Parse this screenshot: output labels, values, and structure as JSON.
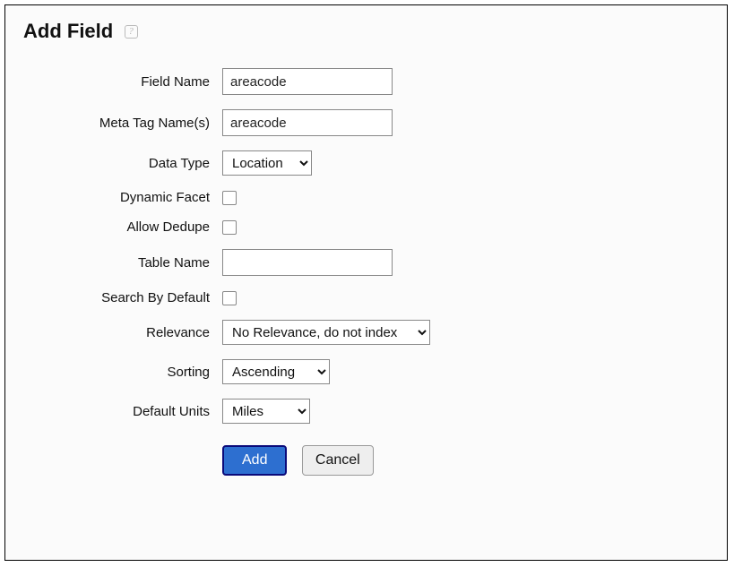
{
  "header": {
    "title": "Add Field"
  },
  "labels": {
    "field_name": "Field Name",
    "meta_tag_names": "Meta Tag Name(s)",
    "data_type": "Data Type",
    "dynamic_facet": "Dynamic Facet",
    "allow_dedupe": "Allow Dedupe",
    "table_name": "Table Name",
    "search_by_default": "Search By Default",
    "relevance": "Relevance",
    "sorting": "Sorting",
    "default_units": "Default Units"
  },
  "values": {
    "field_name": "areacode",
    "meta_tag_names": "areacode",
    "table_name": ""
  },
  "options": {
    "data_type": [
      "Location"
    ],
    "relevance": [
      "No Relevance, do not index"
    ],
    "sorting": [
      "Ascending"
    ],
    "default_units": [
      "Miles"
    ]
  },
  "selected": {
    "data_type": "Location",
    "relevance": "No Relevance, do not index",
    "sorting": "Ascending",
    "default_units": "Miles"
  },
  "actions": {
    "add": "Add",
    "cancel": "Cancel"
  }
}
